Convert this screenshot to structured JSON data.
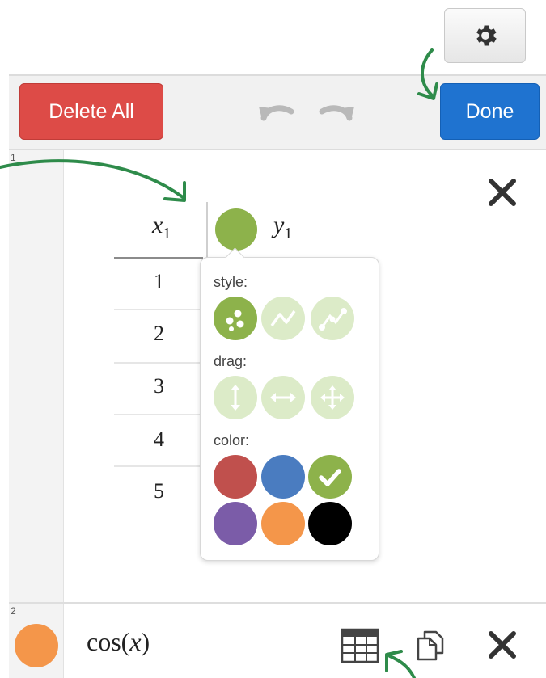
{
  "toolbar": {
    "delete_all_label": "Delete All",
    "done_label": "Done",
    "undo_icon": "undo-icon",
    "redo_icon": "redo-icon",
    "settings_icon": "gear-icon"
  },
  "expressions": [
    {
      "index": "1",
      "type": "table",
      "columns": [
        {
          "header_var": "x",
          "header_sub": "1"
        },
        {
          "header_var": "y",
          "header_sub": "1",
          "color": "#8db24b"
        }
      ],
      "x_values": [
        "1",
        "2",
        "3",
        "4",
        "5"
      ]
    },
    {
      "index": "2",
      "type": "expression",
      "color": "#f4964a",
      "text_func": "cos",
      "text_arg": "x"
    }
  ],
  "style_popover": {
    "style_label": "style:",
    "drag_label": "drag:",
    "color_label": "color:",
    "colors": [
      "#c0504d",
      "#4a7cc0",
      "#8db24b",
      "#7b5ca8",
      "#f4964a",
      "#000000"
    ],
    "selected_color": "#8db24b",
    "accent": "#8db24b",
    "accent_light": "#dcebc8"
  }
}
